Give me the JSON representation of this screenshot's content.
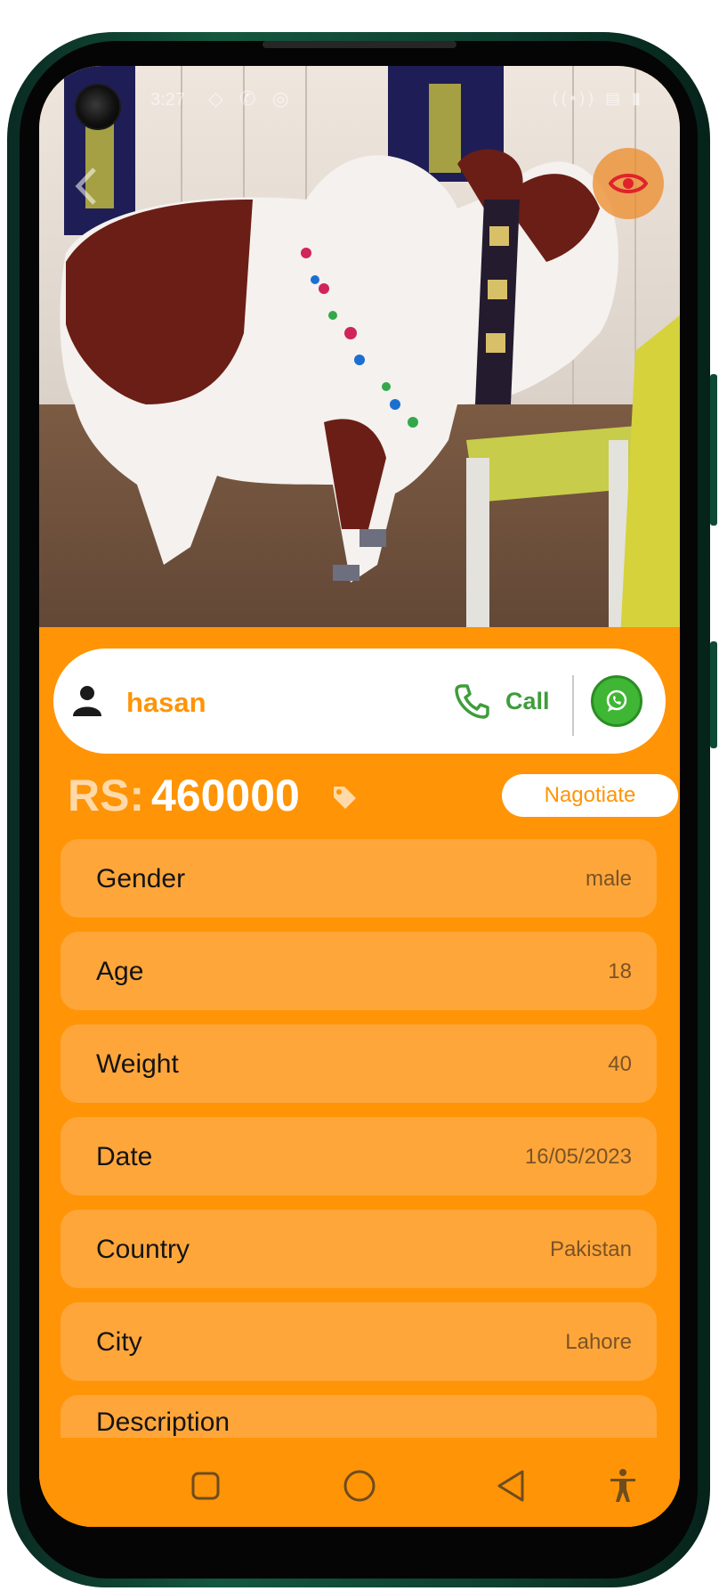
{
  "status_bar": {
    "time": "3:27",
    "left_icons": "◇ ✆ ◎",
    "right_icons": "((•)) ▤ ▮"
  },
  "seller": {
    "name": "hasan",
    "call_label": "Call"
  },
  "price": {
    "prefix": "RS:",
    "value": "460000",
    "negotiate_label": "Nagotiate"
  },
  "details": [
    {
      "label": "Gender",
      "value": "male"
    },
    {
      "label": "Age",
      "value": "18"
    },
    {
      "label": "Weight",
      "value": "40"
    },
    {
      "label": "Date",
      "value": "16/05/2023"
    },
    {
      "label": "Country",
      "value": "Pakistan"
    },
    {
      "label": "City",
      "value": "Lahore"
    },
    {
      "label": "Description",
      "value": ""
    }
  ],
  "icons": {
    "back": "back-arrow-icon",
    "view": "eye-icon",
    "seller": "user-icon",
    "call": "phone-icon",
    "whatsapp": "whatsapp-icon",
    "price_tag": "tag-icon",
    "nav_recents": "square-icon",
    "nav_home": "circle-icon",
    "nav_back": "triangle-back-icon",
    "nav_accessibility": "accessibility-icon"
  },
  "colors": {
    "accent": "#ff9406",
    "row_background": "#ffa63b",
    "call_green": "#3f9d3b",
    "whatsapp_green": "#3fb634",
    "phone_frame": "#14573f"
  }
}
